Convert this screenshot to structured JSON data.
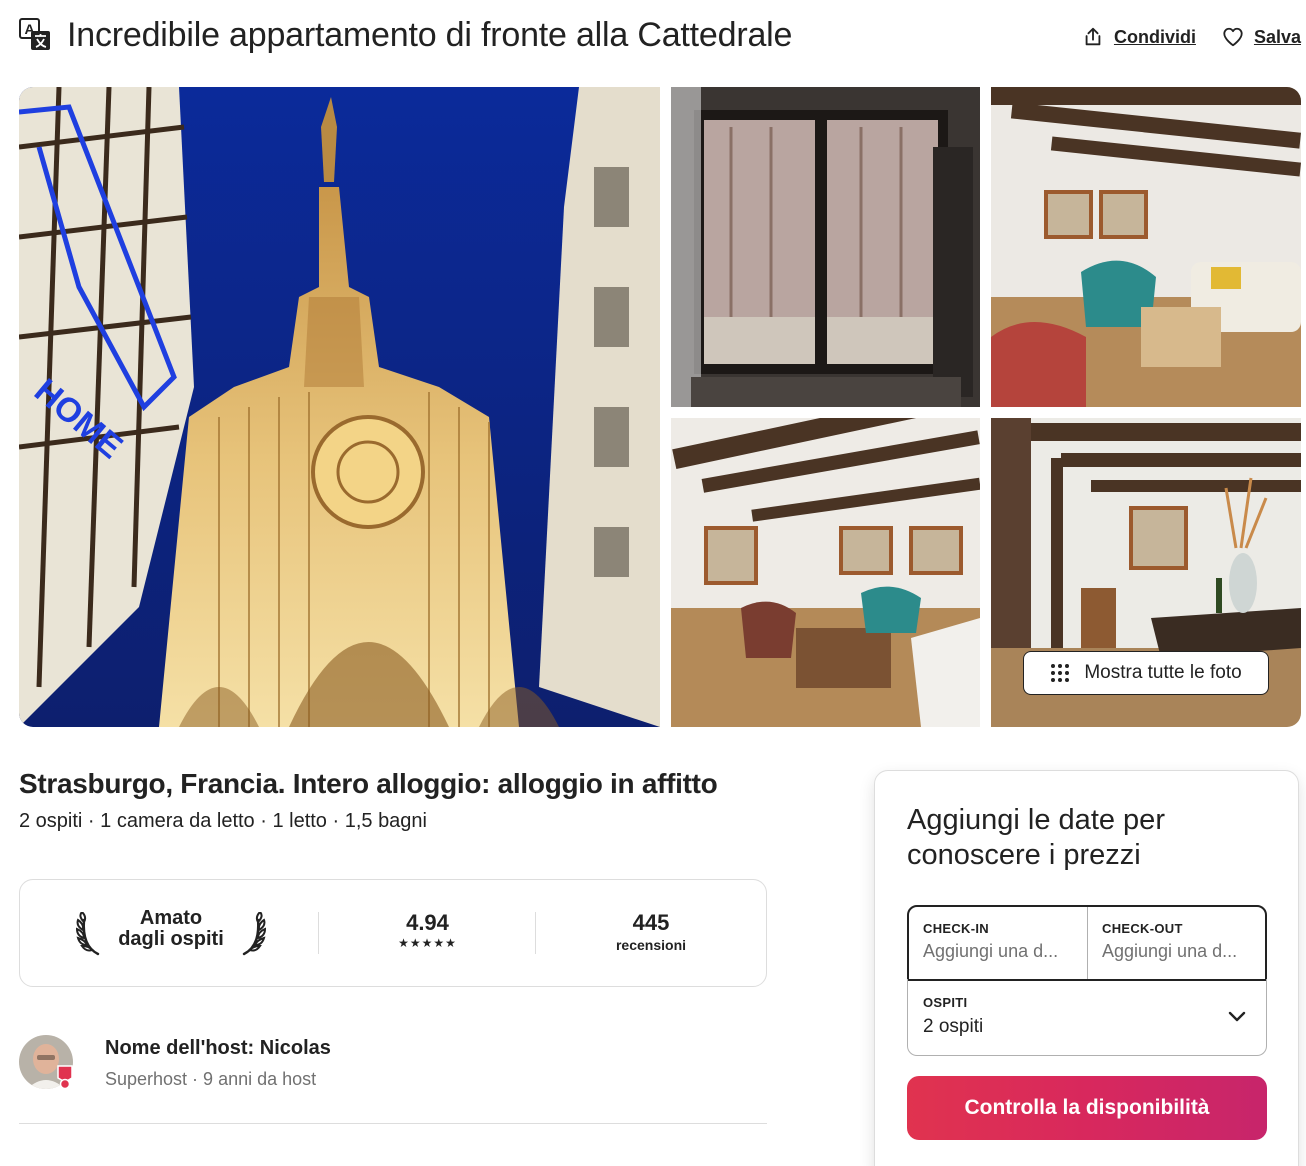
{
  "header": {
    "title": "Incredibile appartamento di fronte alla Cattedrale",
    "share_label": "Condividi",
    "save_label": "Salva"
  },
  "gallery": {
    "show_all_label": "Mostra tutte le foto",
    "main_overlay_text": "HOME"
  },
  "listing": {
    "subtitle": "Strasburgo, Francia. Intero alloggio: alloggio in affitto",
    "details": "2 ospiti · 1 camera da letto · 1 letto · 1,5 bagni"
  },
  "rating": {
    "guest_favorite_line1": "Amato",
    "guest_favorite_line2": "dagli ospiti",
    "score": "4.94",
    "stars": "★★★★★",
    "reviews_count": "445",
    "reviews_label": "recensioni"
  },
  "host": {
    "name": "Nome dell'host: Nicolas",
    "meta": "Superhost · 9 anni da host"
  },
  "booking": {
    "title": "Aggiungi le date per conoscere i prezzi",
    "checkin_label": "CHECK-IN",
    "checkin_placeholder": "Aggiungi una d...",
    "checkout_label": "CHECK-OUT",
    "checkout_placeholder": "Aggiungi una d...",
    "guests_label": "OSPITI",
    "guests_value": "2 ospiti",
    "cta_label": "Controlla la disponibilità"
  },
  "colors": {
    "text": "#222222",
    "muted": "#717171",
    "border": "#dddddd",
    "brand": "#e0334f",
    "brand_end": "#c7256b"
  },
  "icons": {
    "translate": "translate-icon",
    "share": "share-icon",
    "save": "heart-icon",
    "grid": "grid-dots-icon",
    "laurel": "laurel-icon",
    "chevron": "chevron-down-icon",
    "superhost": "superhost-badge-icon"
  }
}
